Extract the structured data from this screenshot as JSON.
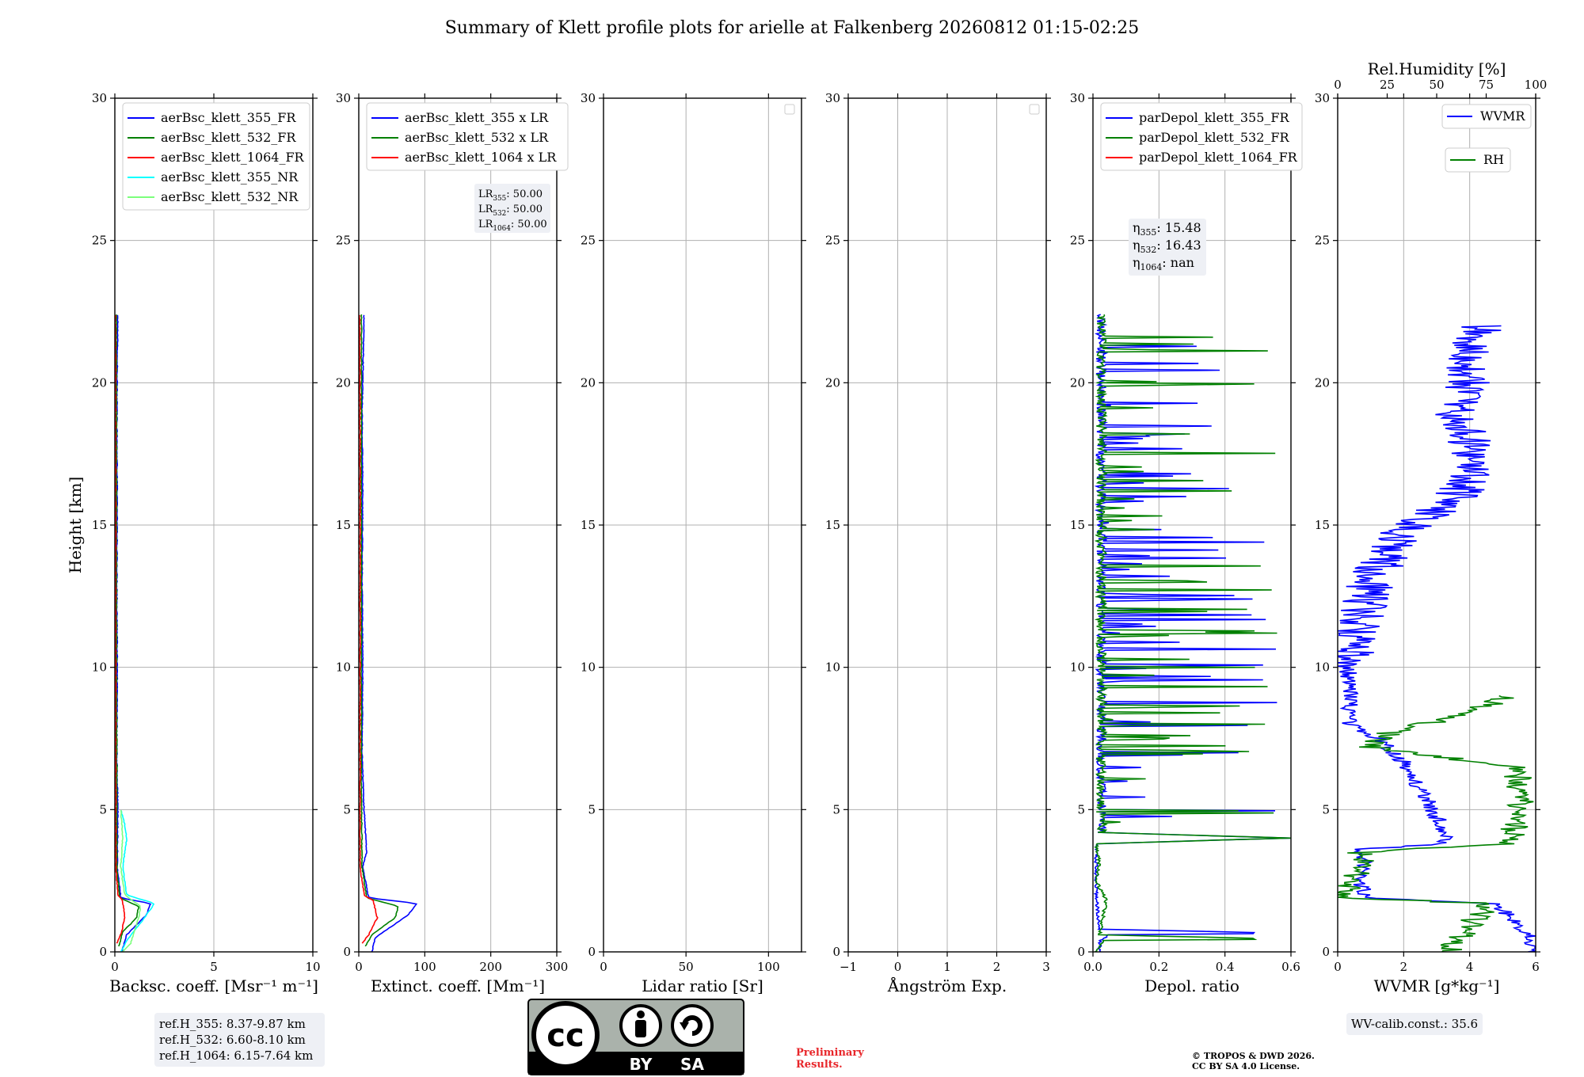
{
  "title": "Summary of Klett profile plots for arielle at Falkenberg 20260812 01:15-02:25",
  "colors": {
    "blue": "#0000ff",
    "green": "#008000",
    "red": "#ff0000",
    "cyan": "#00ffff",
    "lightgreen": "#7cff7c",
    "grid": "#b0b0b0"
  },
  "footer": {
    "ref_lines": [
      "ref.H_355: 8.37-9.87 km",
      "ref.H_532: 6.60-8.10 km",
      "ref.H_1064: 6.15-7.64 km"
    ],
    "preliminary": [
      "Preliminary",
      "Results."
    ],
    "copyright": [
      "© TROPOS & DWD 2026.",
      "CC BY SA 4.0 License."
    ],
    "cc_labels": {
      "cc": "cc",
      "by": "BY",
      "sa": "SA"
    },
    "wv_calib": "WV-calib.const.: 35.6"
  },
  "chart_data": [
    {
      "id": "backscatter",
      "type": "line",
      "xlabel": "Backsc. coeff. [Msr⁻¹ m⁻¹]",
      "ylabel": "Height [km]",
      "xlim": [
        0,
        10
      ],
      "ylim": [
        0,
        30
      ],
      "xticks": [
        "0",
        "5",
        "10"
      ],
      "yticks": [
        "0",
        "5",
        "10",
        "15",
        "20",
        "25",
        "30"
      ],
      "grid": true,
      "legend_position": "top-left",
      "series": [
        {
          "name": "aerBsc_klett_355_FR",
          "color": "blue",
          "profile": [
            [
              0.35,
              0.0
            ],
            [
              0.6,
              0.6
            ],
            [
              1.6,
              1.3
            ],
            [
              1.8,
              1.7
            ],
            [
              0.3,
              1.9
            ],
            [
              0.12,
              3
            ],
            [
              0.15,
              5
            ],
            [
              0.1,
              7
            ],
            [
              0.12,
              10
            ],
            [
              0.1,
              13
            ],
            [
              0.12,
              16
            ],
            [
              0.1,
              19
            ],
            [
              0.15,
              22.4
            ]
          ]
        },
        {
          "name": "aerBsc_klett_532_FR",
          "color": "green",
          "profile": [
            [
              0.2,
              0.2
            ],
            [
              0.4,
              0.7
            ],
            [
              1.1,
              1.2
            ],
            [
              1.2,
              1.6
            ],
            [
              0.25,
              1.9
            ],
            [
              0.1,
              3
            ],
            [
              0.1,
              6
            ],
            [
              0.08,
              10
            ],
            [
              0.08,
              15
            ],
            [
              0.08,
              20
            ],
            [
              0.08,
              22.4
            ]
          ]
        },
        {
          "name": "aerBsc_klett_1064_FR",
          "color": "red",
          "profile": [
            [
              0.1,
              0.3
            ],
            [
              0.3,
              0.6
            ],
            [
              0.5,
              1.2
            ],
            [
              0.4,
              1.8
            ],
            [
              0.15,
              2.0
            ],
            [
              0.05,
              3
            ],
            [
              0.04,
              8
            ],
            [
              0.04,
              15
            ],
            [
              0.03,
              22.4
            ]
          ]
        },
        {
          "name": "aerBsc_klett_355_NR",
          "color": "cyan",
          "profile": [
            [
              0.3,
              0.0
            ],
            [
              0.6,
              0.4
            ],
            [
              1.5,
              1.2
            ],
            [
              2.0,
              1.7
            ],
            [
              0.6,
              2.0
            ],
            [
              0.4,
              3
            ],
            [
              0.6,
              4
            ],
            [
              0.5,
              4.5
            ],
            [
              0.3,
              5
            ]
          ]
        },
        {
          "name": "aerBsc_klett_532_NR",
          "color": "lightgreen",
          "profile": [
            [
              0.4,
              0.0
            ],
            [
              0.8,
              0.3
            ],
            [
              1.2,
              1.2
            ],
            [
              1.3,
              1.6
            ],
            [
              0.5,
              2.0
            ],
            [
              0.3,
              3
            ],
            [
              0.4,
              4
            ],
            [
              0.3,
              5
            ]
          ]
        }
      ]
    },
    {
      "id": "extinction",
      "type": "line",
      "xlabel": "Extinct. coeff. [Mm⁻¹]",
      "xlim": [
        0,
        300
      ],
      "ylim": [
        0,
        30
      ],
      "xticks": [
        "0",
        "100",
        "200",
        "300"
      ],
      "yticks": [
        "0",
        "5",
        "10",
        "15",
        "20",
        "25",
        "30"
      ],
      "grid": true,
      "legend_position": "top-left",
      "annotation": [
        {
          "sym": "LR",
          "sub": "355",
          "val": ": 50.00"
        },
        {
          "sym": "LR",
          "sub": "532",
          "val": ": 50.00"
        },
        {
          "sym": "LR",
          "sub": "1064",
          "val": ": 50.00"
        }
      ],
      "series": [
        {
          "name": "aerBsc_klett_355 x LR",
          "color": "blue",
          "profile": [
            [
              20,
              0.0
            ],
            [
              25,
              0.5
            ],
            [
              75,
              1.3
            ],
            [
              88,
              1.7
            ],
            [
              15,
              1.9
            ],
            [
              6,
              3
            ],
            [
              12,
              3.5
            ],
            [
              8,
              5
            ],
            [
              5,
              7
            ],
            [
              6,
              10
            ],
            [
              5,
              13
            ],
            [
              6,
              16
            ],
            [
              5,
              19
            ],
            [
              8,
              22.4
            ]
          ]
        },
        {
          "name": "aerBsc_klett_532 x LR",
          "color": "green",
          "profile": [
            [
              10,
              0.2
            ],
            [
              20,
              0.6
            ],
            [
              55,
              1.2
            ],
            [
              60,
              1.6
            ],
            [
              12,
              1.9
            ],
            [
              5,
              3
            ],
            [
              4,
              6
            ],
            [
              4,
              10
            ],
            [
              4,
              15
            ],
            [
              4,
              20
            ],
            [
              4,
              22.4
            ]
          ]
        },
        {
          "name": "aerBsc_klett_1064 x LR",
          "color": "red",
          "profile": [
            [
              5,
              0.3
            ],
            [
              15,
              0.6
            ],
            [
              28,
              1.2
            ],
            [
              22,
              1.8
            ],
            [
              8,
              2.0
            ],
            [
              2,
              3
            ],
            [
              2,
              8
            ],
            [
              2,
              15
            ],
            [
              1.5,
              22.4
            ]
          ]
        }
      ]
    },
    {
      "id": "lidar-ratio",
      "type": "line",
      "xlabel": "Lidar ratio [Sr]",
      "xlim": [
        0,
        120
      ],
      "ylim": [
        0,
        30
      ],
      "xticks": [
        "0",
        "50",
        "100"
      ],
      "yticks": [
        "0",
        "5",
        "10",
        "15",
        "20",
        "25",
        "30"
      ],
      "grid": true,
      "legend_position": "top-right",
      "series": []
    },
    {
      "id": "angstrom",
      "type": "line",
      "xlabel": "Ångström Exp.",
      "xlim": [
        -1,
        3
      ],
      "ylim": [
        0,
        30
      ],
      "xticks": [
        "−1",
        "0",
        "1",
        "2",
        "3"
      ],
      "yticks": [
        "0",
        "5",
        "10",
        "15",
        "20",
        "25",
        "30"
      ],
      "grid": true,
      "legend_position": "top-right",
      "series": []
    },
    {
      "id": "depol",
      "type": "line",
      "xlabel": "Depol. ratio",
      "xlim": [
        0,
        0.6
      ],
      "ylim": [
        0,
        30
      ],
      "xticks": [
        "0.0",
        "0.2",
        "0.4",
        "0.6"
      ],
      "yticks": [
        "0",
        "5",
        "10",
        "15",
        "20",
        "25",
        "30"
      ],
      "grid": true,
      "legend_position": "top-left",
      "annotation": [
        {
          "sym": "η",
          "sub": "355",
          "val": ": 15.48"
        },
        {
          "sym": "η",
          "sub": "532",
          "val": ": 16.43"
        },
        {
          "sym": "η",
          "sub": "1064",
          "val": ": nan"
        }
      ],
      "series": [
        {
          "name": "parDepol_klett_355_FR",
          "color": "blue",
          "profile": [
            [
              0.02,
              0.0
            ],
            [
              0.02,
              0.4
            ],
            [
              0.05,
              0.6
            ],
            [
              0.6,
              0.65
            ],
            [
              0.02,
              0.8
            ],
            [
              0.01,
              2
            ],
            [
              0.01,
              3.8
            ],
            [
              0.6,
              4.0
            ],
            [
              0.01,
              4.2
            ],
            [
              0.01,
              22.4
            ]
          ]
        },
        {
          "name": "parDepol_klett_532_FR",
          "color": "green",
          "profile": [
            [
              0.01,
              0.0
            ],
            [
              0.03,
              0.4
            ],
            [
              0.6,
              0.45
            ],
            [
              0.02,
              0.6
            ],
            [
              0.04,
              1.8
            ],
            [
              0.01,
              2.5
            ],
            [
              0.02,
              3.0
            ],
            [
              0.01,
              3.8
            ],
            [
              0.6,
              4.0
            ],
            [
              0.01,
              4.2
            ],
            [
              0.01,
              22.4
            ]
          ]
        },
        {
          "name": "parDepol_klett_1064_FR",
          "color": "red",
          "profile": []
        }
      ]
    },
    {
      "id": "wvmr",
      "type": "line",
      "xlabel": "WVMR [g*kg⁻¹]",
      "x2label": "Rel.Humidity [%]",
      "xlim": [
        0,
        6
      ],
      "x2lim": [
        0,
        100
      ],
      "ylim": [
        0,
        30
      ],
      "xticks": [
        "0",
        "2",
        "4",
        "6"
      ],
      "x2ticks": [
        "0",
        "25",
        "50",
        "75",
        "100"
      ],
      "yticks": [
        "0",
        "5",
        "10",
        "15",
        "20",
        "25",
        "30"
      ],
      "grid": true,
      "legend_position": "top-right",
      "series": [
        {
          "name": "WVMR",
          "color": "blue",
          "axis": "x",
          "profile": [
            [
              6.0,
              0.0
            ],
            [
              5.8,
              0.5
            ],
            [
              5.4,
              1.0
            ],
            [
              5.0,
              1.5
            ],
            [
              4.8,
              1.7
            ],
            [
              0.8,
              1.9
            ],
            [
              0.7,
              2.5
            ],
            [
              0.9,
              3.0
            ],
            [
              0.6,
              3.6
            ],
            [
              3.3,
              3.8
            ],
            [
              3.1,
              4.5
            ],
            [
              2.6,
              5.5
            ],
            [
              2.1,
              6.5
            ],
            [
              1.3,
              7.5
            ],
            [
              0.3,
              8.0
            ],
            [
              0.4,
              9.0
            ],
            [
              0.3,
              10.0
            ],
            [
              0.5,
              11.0
            ],
            [
              0.8,
              12.0
            ],
            [
              1.0,
              13.0
            ],
            [
              1.5,
              14.0
            ],
            [
              2.2,
              15.0
            ],
            [
              3.6,
              16.0
            ],
            [
              4.2,
              17.0
            ],
            [
              4.0,
              18.0
            ],
            [
              3.6,
              19.0
            ],
            [
              3.9,
              20.0
            ],
            [
              4.1,
              21.0
            ],
            [
              4.3,
              22.0
            ]
          ]
        },
        {
          "name": "RH",
          "color": "green",
          "axis": "x2",
          "profile": [
            [
              55,
              0.0
            ],
            [
              62,
              0.5
            ],
            [
              68,
              1.0
            ],
            [
              75,
              1.5
            ],
            [
              75,
              1.7
            ],
            [
              5,
              1.9
            ],
            [
              8,
              2.5
            ],
            [
              12,
              3.0
            ],
            [
              10,
              3.5
            ],
            [
              85,
              3.8
            ],
            [
              90,
              4.5
            ],
            [
              93,
              5.5
            ],
            [
              90,
              6.5
            ],
            [
              15,
              7.2
            ],
            [
              30,
              7.8
            ],
            [
              55,
              8.2
            ],
            [
              80,
              8.8
            ],
            [
              85,
              9.0
            ]
          ]
        }
      ]
    }
  ]
}
